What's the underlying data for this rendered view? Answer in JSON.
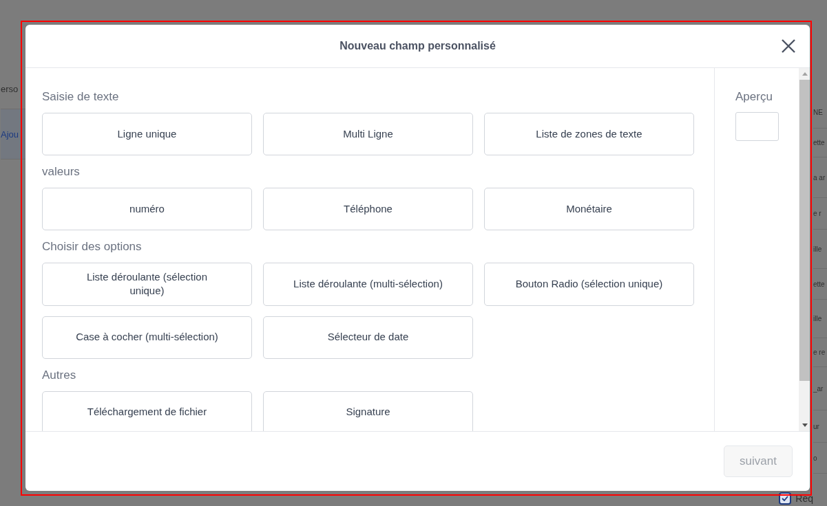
{
  "background": {
    "left_items": [
      {
        "label": "erso",
        "selected": false
      },
      {
        "label": "Ajou",
        "selected": true
      }
    ],
    "right_items": [
      "NE",
      "ette",
      "a ar",
      "e r",
      "ille",
      "ette",
      "ille",
      "e re",
      "_ar",
      "ur",
      "o"
    ],
    "checkbox": {
      "label": "Req",
      "checked": true
    }
  },
  "dialog": {
    "title": "Nouveau champ personnalisé",
    "sections": [
      {
        "heading": "Saisie de texte",
        "options": [
          "Ligne unique",
          "Multi Ligne",
          "Liste de zones de texte"
        ]
      },
      {
        "heading": "valeurs",
        "options": [
          "numéro",
          "Téléphone",
          "Monétaire"
        ]
      },
      {
        "heading": "Choisir des options",
        "options": [
          "Liste déroulante (sélection unique)",
          "Liste déroulante (multi-sélection)",
          "Bouton Radio (sélection unique)",
          "Case à cocher (multi-sélection)",
          "Sélecteur de date"
        ]
      },
      {
        "heading": "Autres",
        "options": [
          "Téléchargement de fichier",
          "Signature"
        ]
      }
    ],
    "preview": {
      "label": "Aperçu"
    },
    "next_button": {
      "label": "suivant",
      "disabled": true
    }
  }
}
